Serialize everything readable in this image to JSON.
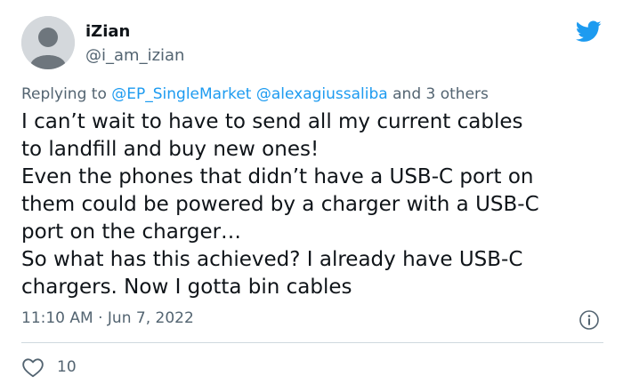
{
  "user": {
    "display_name": "iZian",
    "handle": "@i_am_izian"
  },
  "reply": {
    "prefix": "Replying to",
    "mentions": [
      "@EP_SingleMarket",
      "@alexagiussaliba"
    ],
    "suffix": "and 3 others"
  },
  "tweet": {
    "lines": [
      "I can’t wait to have to send all my current cables",
      "to landfill and buy new ones!",
      "Even the phones that didn’t have a USB-C port on",
      "them could be powered by a charger with a USB-C",
      "port on the charger…",
      "So what has this achieved? I already have USB-C",
      "chargers. Now I gotta bin cables"
    ],
    "time": "11:10 AM",
    "separator": "·",
    "date": "Jun 7, 2022"
  },
  "engagement": {
    "likes": "10"
  },
  "icons": {
    "brand": "twitter-bird-icon",
    "info": "info-icon",
    "like": "heart-icon"
  },
  "colors": {
    "brand_blue": "#1d9bf0",
    "text": "#0f1419",
    "secondary_text": "#536471",
    "divider": "#cfd9de",
    "avatar_bg": "#d4d8dc"
  }
}
